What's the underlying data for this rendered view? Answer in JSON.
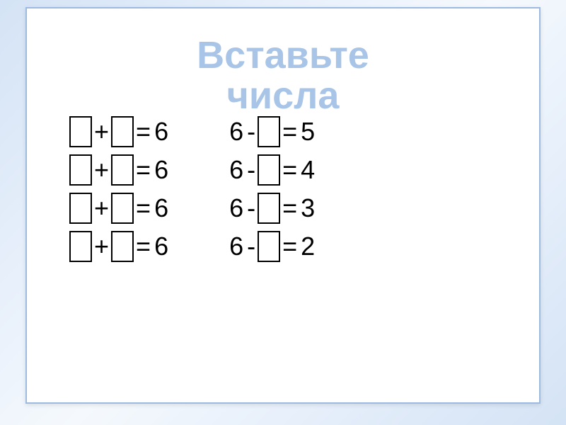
{
  "title_line1": "Вставьте",
  "title_line2": "числа",
  "left_column": [
    {
      "op": "+",
      "result": "6"
    },
    {
      "op": "+",
      "result": "6"
    },
    {
      "op": "+",
      "result": "6"
    },
    {
      "op": "+",
      "result": "6"
    }
  ],
  "right_column": [
    {
      "lhs": "6",
      "op": "-",
      "result": "5"
    },
    {
      "lhs": "6",
      "op": "-",
      "result": "4"
    },
    {
      "lhs": "6",
      "op": "-",
      "result": "3"
    },
    {
      "lhs": "6",
      "op": "-",
      "result": "2"
    }
  ],
  "equals": "="
}
